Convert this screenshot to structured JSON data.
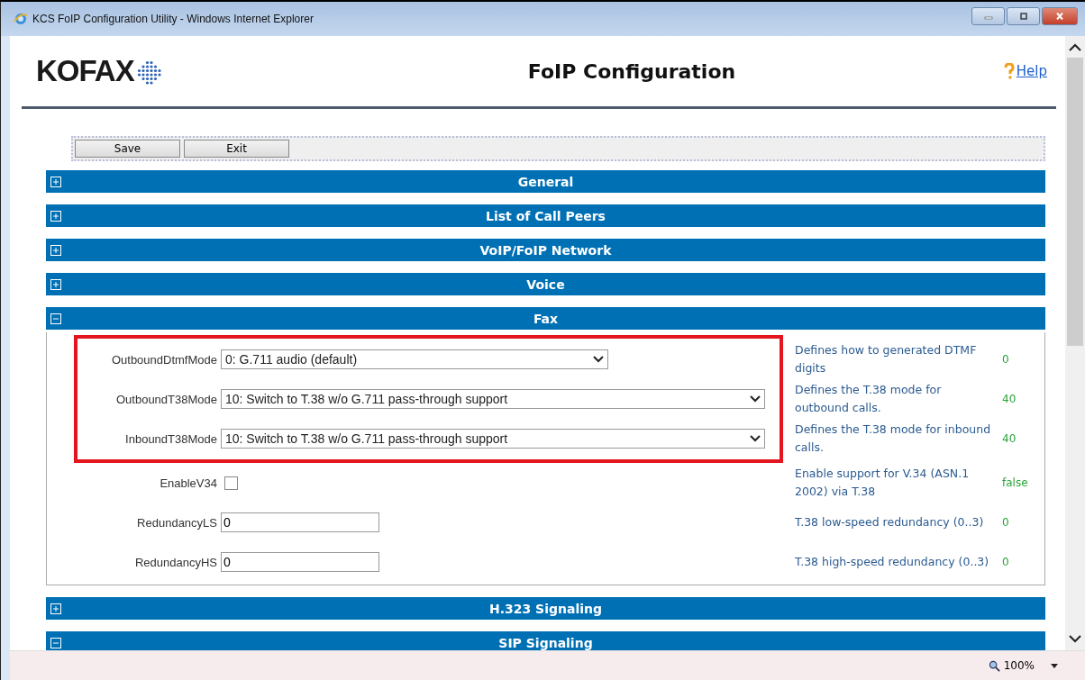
{
  "window": {
    "title": "KCS FoIP Configuration Utility - Windows Internet Explorer"
  },
  "header": {
    "logo": "KOFAX",
    "title": "FoIP Configuration",
    "help": "Help"
  },
  "toolbar": {
    "buttons": [
      "Save",
      "Exit"
    ]
  },
  "sections": [
    {
      "title": "General",
      "expanded": false
    },
    {
      "title": "List of Call Peers",
      "expanded": false
    },
    {
      "title": "VoIP/FoIP Network",
      "expanded": false
    },
    {
      "title": "Voice",
      "expanded": false
    },
    {
      "title": "Fax",
      "expanded": true,
      "fields": [
        {
          "kind": "select",
          "label": "OutboundDtmfMode",
          "value": "0: G.711 audio (default)",
          "short": true,
          "highlighted": true,
          "description": "Defines how to generated DTMF digits",
          "current": "0"
        },
        {
          "kind": "select",
          "label": "OutboundT38Mode",
          "value": "10: Switch to T.38 w/o G.711 pass-through support",
          "short": false,
          "highlighted": true,
          "description": "Defines the T.38 mode for outbound calls.",
          "current": "40"
        },
        {
          "kind": "select",
          "label": "InboundT38Mode",
          "value": "10: Switch to T.38 w/o G.711 pass-through support",
          "short": false,
          "highlighted": true,
          "description": "Defines the T.38 mode for inbound calls.",
          "current": "40"
        },
        {
          "kind": "checkbox",
          "label": "EnableV34",
          "checked": false,
          "highlighted": false,
          "description": "Enable support for V.34 (ASN.1 2002) via T.38",
          "current": "false"
        },
        {
          "kind": "text",
          "label": "RedundancyLS",
          "value": "0",
          "highlighted": false,
          "description": "T.38 low-speed redundancy (0..3)",
          "current": "0"
        },
        {
          "kind": "text",
          "label": "RedundancyHS",
          "value": "0",
          "highlighted": false,
          "description": "T.38 high-speed redundancy (0..3)",
          "current": "0"
        }
      ]
    },
    {
      "title": "H.323 Signaling",
      "expanded": false
    },
    {
      "title": "SIP Signaling",
      "expanded": true
    }
  ],
  "status_bar": {
    "zoom": "100%"
  }
}
